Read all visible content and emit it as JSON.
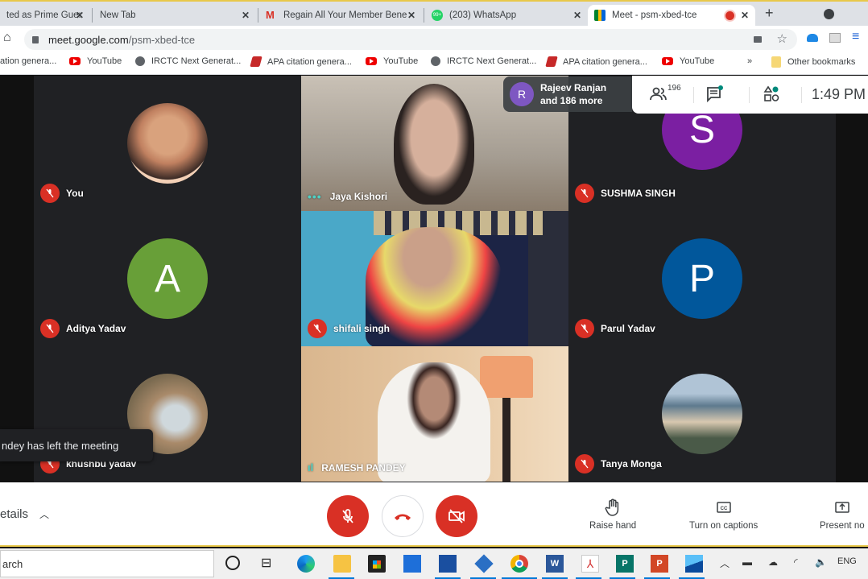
{
  "browser": {
    "tabs": [
      {
        "title": "ted as Prime Gue:",
        "favicon": "none",
        "active": false
      },
      {
        "title": "New Tab",
        "favicon": "none",
        "active": false
      },
      {
        "title": "Regain All Your Member Bene",
        "favicon": "gmail-icon",
        "active": false
      },
      {
        "title": "(203) WhatsApp",
        "favicon": "whatsapp-icon",
        "badge": "99+",
        "active": false
      },
      {
        "title": "Meet - psm-xbed-tce",
        "favicon": "meet-icon",
        "active": true,
        "recording": true
      }
    ],
    "url_host": "meet.google.com",
    "url_path": "/psm-xbed-tce",
    "bookmarks": [
      {
        "label": "ation genera...",
        "icon": "none"
      },
      {
        "label": "YouTube",
        "icon": "youtube-icon"
      },
      {
        "label": "IRCTC Next Generat...",
        "icon": "globe-icon"
      },
      {
        "label": "APA citation genera...",
        "icon": "apa-icon"
      },
      {
        "label": "YouTube",
        "icon": "youtube-icon"
      },
      {
        "label": "IRCTC Next Generat...",
        "icon": "globe-icon"
      },
      {
        "label": "APA citation genera...",
        "icon": "apa-icon"
      },
      {
        "label": "YouTube",
        "icon": "youtube-icon"
      }
    ],
    "overflow": "»",
    "other_bookmarks": "Other bookmarks"
  },
  "meet": {
    "join_notice": {
      "initial": "R",
      "line1": "Rajeev Ranjan",
      "line2": "and 186 more",
      "color": "#7e57c2"
    },
    "participant_count": "196",
    "clock": "1:49 PM",
    "participants": [
      {
        "name": "You",
        "type": "photo",
        "muted": true,
        "photo_color": "#c9906b"
      },
      {
        "name": "Jaya Kishori",
        "type": "video",
        "muted": false,
        "speaking": "dots",
        "bg": "#b7afa5"
      },
      {
        "name": "SUSHMA SINGH",
        "type": "initial",
        "initial": "S",
        "color": "#7b1fa2",
        "muted": true
      },
      {
        "name": "Aditya Yadav",
        "type": "initial",
        "initial": "A",
        "color": "#689f38",
        "muted": true
      },
      {
        "name": "shifali singh",
        "type": "video",
        "muted": true,
        "bg": "#4aa8c8"
      },
      {
        "name": "Parul Yadav",
        "type": "initial",
        "initial": "P",
        "color": "#01579b",
        "muted": true
      },
      {
        "name": "khushbu yadav",
        "type": "photo",
        "muted": true,
        "photo_color": "#a98a6a"
      },
      {
        "name": "RAMESH PANDEY",
        "type": "video",
        "muted": false,
        "speaking": "bars",
        "bg": "#d8b894"
      },
      {
        "name": "Tanya Monga",
        "type": "photo",
        "muted": true,
        "photo_color": "#8ea0a8"
      }
    ],
    "toast": "ndey has left the meeting",
    "details_label": "etails",
    "actions": [
      {
        "label": "Raise hand",
        "icon": "raise-hand-icon"
      },
      {
        "label": "Turn on captions",
        "icon": "captions-icon"
      },
      {
        "label": "Present no",
        "icon": "present-icon"
      }
    ],
    "colors": {
      "danger": "#d93025",
      "tile_bg": "#202124"
    }
  },
  "taskbar": {
    "search_placeholder": "arch",
    "lang": "ENG"
  }
}
